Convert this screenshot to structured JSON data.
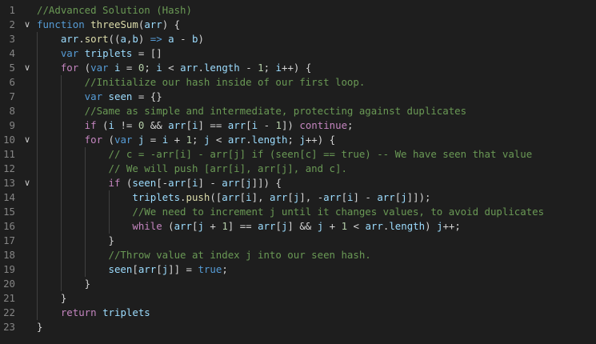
{
  "editor": {
    "language": "javascript",
    "theme": {
      "background": "#1e1e1e",
      "line_number": "#858585",
      "comment": "#6a9955",
      "keyword": "#569cd6",
      "control": "#c586c0",
      "function": "#dcdcaa",
      "variable": "#9cdcfe",
      "number": "#b5cea8",
      "text": "#d4d4d4"
    },
    "fold_icon": "chevron-down-icon",
    "lines": [
      {
        "n": "1",
        "indent": 0,
        "fold": false,
        "tokens": [
          {
            "t": "cm",
            "v": "//Advanced Solution (Hash)"
          }
        ]
      },
      {
        "n": "2",
        "indent": 0,
        "fold": true,
        "tokens": [
          {
            "t": "kw",
            "v": "function"
          },
          {
            "t": "op",
            "v": " "
          },
          {
            "t": "fn",
            "v": "threeSum"
          },
          {
            "t": "op",
            "v": "("
          },
          {
            "t": "vr",
            "v": "arr"
          },
          {
            "t": "op",
            "v": ") {"
          }
        ]
      },
      {
        "n": "3",
        "indent": 1,
        "fold": false,
        "tokens": [
          {
            "t": "vr",
            "v": "arr"
          },
          {
            "t": "op",
            "v": "."
          },
          {
            "t": "fn",
            "v": "sort"
          },
          {
            "t": "op",
            "v": "(("
          },
          {
            "t": "vr",
            "v": "a"
          },
          {
            "t": "op",
            "v": ","
          },
          {
            "t": "vr",
            "v": "b"
          },
          {
            "t": "op",
            "v": ") "
          },
          {
            "t": "kw",
            "v": "=>"
          },
          {
            "t": "op",
            "v": " "
          },
          {
            "t": "vr",
            "v": "a"
          },
          {
            "t": "op",
            "v": " - "
          },
          {
            "t": "vr",
            "v": "b"
          },
          {
            "t": "op",
            "v": ")"
          }
        ]
      },
      {
        "n": "4",
        "indent": 1,
        "fold": false,
        "tokens": [
          {
            "t": "kw",
            "v": "var"
          },
          {
            "t": "op",
            "v": " "
          },
          {
            "t": "vr",
            "v": "triplets"
          },
          {
            "t": "op",
            "v": " = []"
          }
        ]
      },
      {
        "n": "5",
        "indent": 1,
        "fold": true,
        "tokens": [
          {
            "t": "ctl",
            "v": "for"
          },
          {
            "t": "op",
            "v": " ("
          },
          {
            "t": "kw",
            "v": "var"
          },
          {
            "t": "op",
            "v": " "
          },
          {
            "t": "vr",
            "v": "i"
          },
          {
            "t": "op",
            "v": " = "
          },
          {
            "t": "nm",
            "v": "0"
          },
          {
            "t": "op",
            "v": "; "
          },
          {
            "t": "vr",
            "v": "i"
          },
          {
            "t": "op",
            "v": " < "
          },
          {
            "t": "vr",
            "v": "arr"
          },
          {
            "t": "op",
            "v": "."
          },
          {
            "t": "vr",
            "v": "length"
          },
          {
            "t": "op",
            "v": " - "
          },
          {
            "t": "nm",
            "v": "1"
          },
          {
            "t": "op",
            "v": "; "
          },
          {
            "t": "vr",
            "v": "i"
          },
          {
            "t": "op",
            "v": "++) {"
          }
        ]
      },
      {
        "n": "6",
        "indent": 2,
        "fold": false,
        "tokens": [
          {
            "t": "cm",
            "v": "//Initialize our hash inside of our first loop."
          }
        ]
      },
      {
        "n": "7",
        "indent": 2,
        "fold": false,
        "tokens": [
          {
            "t": "kw",
            "v": "var"
          },
          {
            "t": "op",
            "v": " "
          },
          {
            "t": "vr",
            "v": "seen"
          },
          {
            "t": "op",
            "v": " = {}"
          }
        ]
      },
      {
        "n": "8",
        "indent": 2,
        "fold": false,
        "tokens": [
          {
            "t": "cm",
            "v": "//Same as simple and intermediate, protecting against duplicates"
          }
        ]
      },
      {
        "n": "9",
        "indent": 2,
        "fold": false,
        "tokens": [
          {
            "t": "ctl",
            "v": "if"
          },
          {
            "t": "op",
            "v": " ("
          },
          {
            "t": "vr",
            "v": "i"
          },
          {
            "t": "op",
            "v": " != "
          },
          {
            "t": "nm",
            "v": "0"
          },
          {
            "t": "op",
            "v": " && "
          },
          {
            "t": "vr",
            "v": "arr"
          },
          {
            "t": "op",
            "v": "["
          },
          {
            "t": "vr",
            "v": "i"
          },
          {
            "t": "op",
            "v": "] == "
          },
          {
            "t": "vr",
            "v": "arr"
          },
          {
            "t": "op",
            "v": "["
          },
          {
            "t": "vr",
            "v": "i"
          },
          {
            "t": "op",
            "v": " - "
          },
          {
            "t": "nm",
            "v": "1"
          },
          {
            "t": "op",
            "v": "]) "
          },
          {
            "t": "ctl",
            "v": "continue"
          },
          {
            "t": "op",
            "v": ";"
          }
        ]
      },
      {
        "n": "10",
        "indent": 2,
        "fold": true,
        "tokens": [
          {
            "t": "ctl",
            "v": "for"
          },
          {
            "t": "op",
            "v": " ("
          },
          {
            "t": "kw",
            "v": "var"
          },
          {
            "t": "op",
            "v": " "
          },
          {
            "t": "vr",
            "v": "j"
          },
          {
            "t": "op",
            "v": " = "
          },
          {
            "t": "vr",
            "v": "i"
          },
          {
            "t": "op",
            "v": " + "
          },
          {
            "t": "nm",
            "v": "1"
          },
          {
            "t": "op",
            "v": "; "
          },
          {
            "t": "vr",
            "v": "j"
          },
          {
            "t": "op",
            "v": " < "
          },
          {
            "t": "vr",
            "v": "arr"
          },
          {
            "t": "op",
            "v": "."
          },
          {
            "t": "vr",
            "v": "length"
          },
          {
            "t": "op",
            "v": "; "
          },
          {
            "t": "vr",
            "v": "j"
          },
          {
            "t": "op",
            "v": "++) {"
          }
        ]
      },
      {
        "n": "11",
        "indent": 3,
        "fold": false,
        "tokens": [
          {
            "t": "cm",
            "v": "// c = -arr[i] - arr[j] if (seen[c] == true) -- We have seen that value"
          }
        ]
      },
      {
        "n": "12",
        "indent": 3,
        "fold": false,
        "tokens": [
          {
            "t": "cm",
            "v": "// We will push [arr[i], arr[j], and c]."
          }
        ]
      },
      {
        "n": "13",
        "indent": 3,
        "fold": true,
        "tokens": [
          {
            "t": "ctl",
            "v": "if"
          },
          {
            "t": "op",
            "v": " ("
          },
          {
            "t": "vr",
            "v": "seen"
          },
          {
            "t": "op",
            "v": "[-"
          },
          {
            "t": "vr",
            "v": "arr"
          },
          {
            "t": "op",
            "v": "["
          },
          {
            "t": "vr",
            "v": "i"
          },
          {
            "t": "op",
            "v": "] - "
          },
          {
            "t": "vr",
            "v": "arr"
          },
          {
            "t": "op",
            "v": "["
          },
          {
            "t": "vr",
            "v": "j"
          },
          {
            "t": "op",
            "v": "]]) {"
          }
        ]
      },
      {
        "n": "14",
        "indent": 4,
        "fold": false,
        "tokens": [
          {
            "t": "vr",
            "v": "triplets"
          },
          {
            "t": "op",
            "v": "."
          },
          {
            "t": "fn",
            "v": "push"
          },
          {
            "t": "op",
            "v": "(["
          },
          {
            "t": "vr",
            "v": "arr"
          },
          {
            "t": "op",
            "v": "["
          },
          {
            "t": "vr",
            "v": "i"
          },
          {
            "t": "op",
            "v": "], "
          },
          {
            "t": "vr",
            "v": "arr"
          },
          {
            "t": "op",
            "v": "["
          },
          {
            "t": "vr",
            "v": "j"
          },
          {
            "t": "op",
            "v": "], -"
          },
          {
            "t": "vr",
            "v": "arr"
          },
          {
            "t": "op",
            "v": "["
          },
          {
            "t": "vr",
            "v": "i"
          },
          {
            "t": "op",
            "v": "] - "
          },
          {
            "t": "vr",
            "v": "arr"
          },
          {
            "t": "op",
            "v": "["
          },
          {
            "t": "vr",
            "v": "j"
          },
          {
            "t": "op",
            "v": "]]);"
          }
        ]
      },
      {
        "n": "15",
        "indent": 4,
        "fold": false,
        "tokens": [
          {
            "t": "cm",
            "v": "//We need to increment j until it changes values, to avoid duplicates"
          }
        ]
      },
      {
        "n": "16",
        "indent": 4,
        "fold": false,
        "tokens": [
          {
            "t": "ctl",
            "v": "while"
          },
          {
            "t": "op",
            "v": " ("
          },
          {
            "t": "vr",
            "v": "arr"
          },
          {
            "t": "op",
            "v": "["
          },
          {
            "t": "vr",
            "v": "j"
          },
          {
            "t": "op",
            "v": " + "
          },
          {
            "t": "nm",
            "v": "1"
          },
          {
            "t": "op",
            "v": "] == "
          },
          {
            "t": "vr",
            "v": "arr"
          },
          {
            "t": "op",
            "v": "["
          },
          {
            "t": "vr",
            "v": "j"
          },
          {
            "t": "op",
            "v": "] && "
          },
          {
            "t": "vr",
            "v": "j"
          },
          {
            "t": "op",
            "v": " + "
          },
          {
            "t": "nm",
            "v": "1"
          },
          {
            "t": "op",
            "v": " < "
          },
          {
            "t": "vr",
            "v": "arr"
          },
          {
            "t": "op",
            "v": "."
          },
          {
            "t": "vr",
            "v": "length"
          },
          {
            "t": "op",
            "v": ") "
          },
          {
            "t": "vr",
            "v": "j"
          },
          {
            "t": "op",
            "v": "++;"
          }
        ]
      },
      {
        "n": "17",
        "indent": 3,
        "fold": false,
        "tokens": [
          {
            "t": "op",
            "v": "}"
          }
        ]
      },
      {
        "n": "18",
        "indent": 3,
        "fold": false,
        "tokens": [
          {
            "t": "cm",
            "v": "//Throw value at index j into our seen hash."
          }
        ]
      },
      {
        "n": "19",
        "indent": 3,
        "fold": false,
        "tokens": [
          {
            "t": "vr",
            "v": "seen"
          },
          {
            "t": "op",
            "v": "["
          },
          {
            "t": "vr",
            "v": "arr"
          },
          {
            "t": "op",
            "v": "["
          },
          {
            "t": "vr",
            "v": "j"
          },
          {
            "t": "op",
            "v": "]] = "
          },
          {
            "t": "kw",
            "v": "true"
          },
          {
            "t": "op",
            "v": ";"
          }
        ]
      },
      {
        "n": "20",
        "indent": 2,
        "fold": false,
        "tokens": [
          {
            "t": "op",
            "v": "}"
          }
        ]
      },
      {
        "n": "21",
        "indent": 1,
        "fold": false,
        "tokens": [
          {
            "t": "op",
            "v": "}"
          }
        ]
      },
      {
        "n": "22",
        "indent": 1,
        "fold": false,
        "tokens": [
          {
            "t": "ctl",
            "v": "return"
          },
          {
            "t": "op",
            "v": " "
          },
          {
            "t": "vr",
            "v": "triplets"
          }
        ]
      },
      {
        "n": "23",
        "indent": 0,
        "fold": false,
        "tokens": [
          {
            "t": "op",
            "v": "}"
          }
        ]
      }
    ]
  }
}
